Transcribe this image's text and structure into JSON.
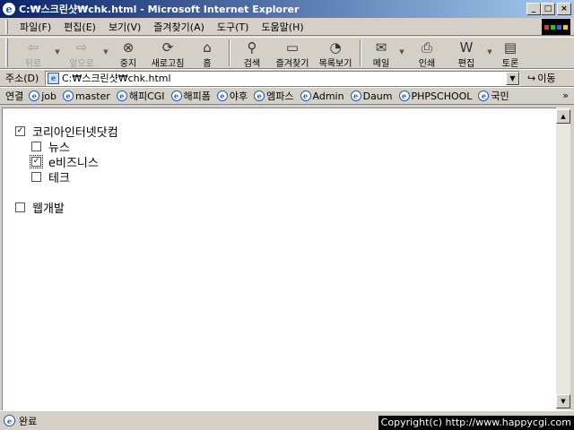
{
  "window": {
    "title": "C:₩스크린샷₩chk.html - Microsoft Internet Explorer",
    "minimize": "_",
    "maximize": "□",
    "close": "×"
  },
  "menu": [
    "파일(F)",
    "편집(E)",
    "보기(V)",
    "즐겨찾기(A)",
    "도구(T)",
    "도움말(H)"
  ],
  "toolbar": {
    "back": "뒤로",
    "forward": "앞으로",
    "stop": "중지",
    "refresh": "새로고침",
    "home": "홈",
    "search": "검색",
    "favorites": "즐겨찾기",
    "history": "목록보기",
    "mail": "메일",
    "print": "인쇄",
    "edit": "편집",
    "discuss": "토론"
  },
  "address": {
    "label": "주소(D)",
    "url": "C:₩스크린샷₩chk.html",
    "go": "이동"
  },
  "links": {
    "label": "연결",
    "items": [
      "job",
      "master",
      "해피CGI",
      "해피폼",
      "야후",
      "엠파스",
      "Admin",
      "Daum",
      "PHPSCHOOL",
      "국민"
    ],
    "more": "»"
  },
  "tree": {
    "root1": {
      "label": "코리아인터넷닷컴",
      "checked": true
    },
    "children": [
      {
        "label": "뉴스",
        "checked": false
      },
      {
        "label": "e비즈니스",
        "checked": true
      },
      {
        "label": "테크",
        "checked": false
      }
    ],
    "root2": {
      "label": "웹개발",
      "checked": false
    }
  },
  "status": {
    "text": "완료",
    "copyright": "Copyright(c) http://www.happycgi.com"
  }
}
